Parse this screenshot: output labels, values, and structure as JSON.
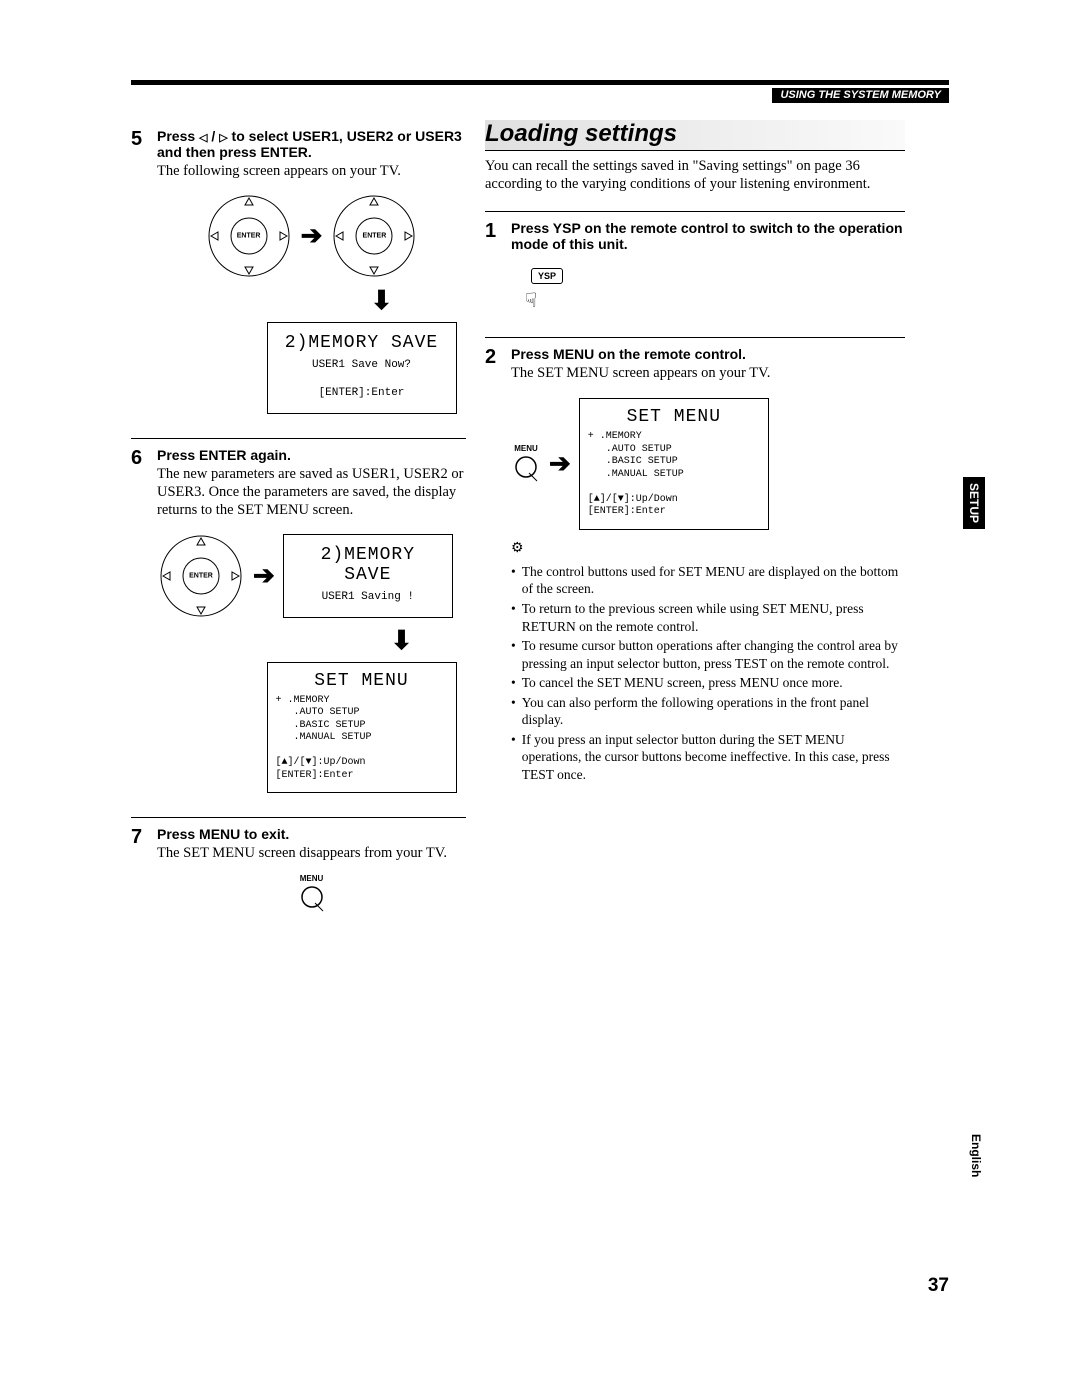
{
  "header": {
    "section": "USING THE SYSTEM MEMORY"
  },
  "page_number": "37",
  "side_tabs": {
    "setup": "SETUP",
    "english": "English"
  },
  "left": {
    "step5": {
      "num": "5",
      "bold_a": "Press ",
      "bold_b": " to select USER1, USER2 or USER3 and then press ENTER.",
      "body": "The following screen appears on your TV.",
      "remote_label": "ENTER",
      "lcd_title": "2)MEMORY SAVE",
      "lcd_line1": "USER1 Save Now?",
      "lcd_line2": "[ENTER]:Enter"
    },
    "step6": {
      "num": "6",
      "bold": "Press ENTER again.",
      "body": "The new parameters are saved as USER1, USER2 or USER3. Once the parameters are saved, the display returns to the SET MENU screen.",
      "remote_label": "ENTER",
      "lcd_title": "2)MEMORY SAVE",
      "lcd_line1": "USER1 Saving !",
      "setmenu_title": "SET MENU",
      "setmenu_lines": "+ .MEMORY\n   .AUTO SETUP\n   .BASIC SETUP\n   .MANUAL SETUP\n\n[▲]/[▼]:Up/Down\n[ENTER]:Enter"
    },
    "step7": {
      "num": "7",
      "bold": "Press MENU to exit.",
      "body": "The SET MENU screen disappears from your TV.",
      "menu_label": "MENU"
    }
  },
  "right": {
    "heading": "Loading settings",
    "intro": "You can recall the settings saved in \"Saving settings\" on page 36 according to the varying conditions of your listening environment.",
    "step1": {
      "num": "1",
      "bold": "Press YSP on the remote control to switch to the operation mode of this unit.",
      "btn": "YSP"
    },
    "step2": {
      "num": "2",
      "bold": "Press MENU on the remote control.",
      "body": "The SET MENU screen appears on your TV.",
      "menu_label": "MENU",
      "setmenu_title": "SET MENU",
      "setmenu_lines": "+ .MEMORY\n   .AUTO SETUP\n   .BASIC SETUP\n   .MANUAL SETUP\n\n[▲]/[▼]:Up/Down\n[ENTER]:Enter"
    },
    "notes": [
      "The control buttons used for SET MENU are displayed on the bottom of the screen.",
      "To return to the previous screen while using SET MENU, press RETURN on the remote control.",
      "To resume cursor button operations after changing the control area by pressing an input selector button, press TEST on the remote control.",
      "To cancel the SET MENU screen, press MENU once more.",
      "You can also perform the following operations in the front panel display.",
      "If you press an input selector button during the SET MENU operations, the cursor buttons become ineffective. In this case, press TEST once."
    ]
  }
}
